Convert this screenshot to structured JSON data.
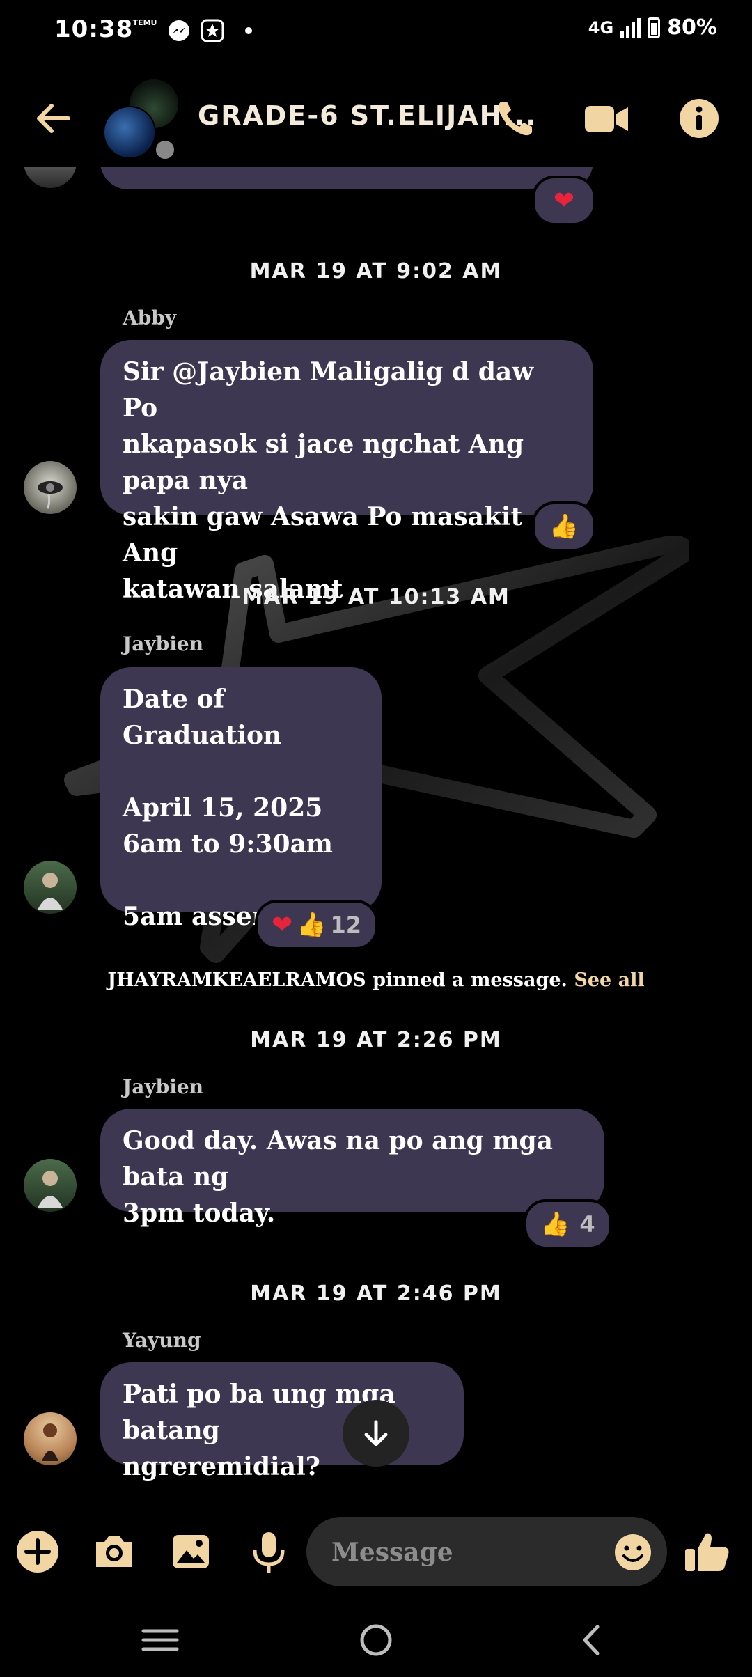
{
  "status_bar": {
    "time": "10:38",
    "notif_icon_1": "TEMU",
    "network": "4G",
    "battery": "80%"
  },
  "header": {
    "title": "GRADE-6 ST.ELIJAH...",
    "icons": [
      "back-arrow-icon",
      "phone-icon",
      "video-camera-icon",
      "info-icon"
    ],
    "accent": "#f1d5a3"
  },
  "messages": {
    "m0": {
      "reaction": "heart"
    },
    "date1": "MAR 19 AT 9:02 AM",
    "m1": {
      "sender": "Abby",
      "lines": [
        "Sir @Jaybien Maligalig d daw Po",
        "nkapasok si jace ngchat Ang papa nya",
        "sakin gaw Asawa Po masakit Ang",
        "katawan salamt"
      ]
    },
    "date2": "MAR 19 AT 10:13 AM",
    "m2": {
      "sender": "Jaybien",
      "lines": [
        "Date of Graduation",
        "",
        "April 15, 2025",
        "6am to 9:30am",
        "",
        "5am assembly"
      ],
      "reaction_count": "12"
    },
    "pinned": {
      "text": "JHAYRAMKEAELRAMOS pinned a message.",
      "link": "See all"
    },
    "date3": "MAR 19 AT 2:26 PM",
    "m3": {
      "sender": "Jaybien",
      "lines": [
        "Good day. Awas na po ang mga bata ng",
        "3pm today."
      ],
      "reaction_count": "4"
    },
    "date4": "MAR 19 AT 2:46 PM",
    "m4": {
      "sender": "Yayung",
      "lines": [
        "Pati po ba ung mga batang",
        "ngreremidial?"
      ]
    }
  },
  "composer": {
    "placeholder": "Message",
    "icons": [
      "plus-icon",
      "camera-icon",
      "gallery-icon",
      "microphone-icon",
      "emoji-icon",
      "thumbs-up-icon"
    ]
  },
  "colors": {
    "bubble": "#3d3752",
    "background": "#000000",
    "accent": "#f1d5a3"
  }
}
